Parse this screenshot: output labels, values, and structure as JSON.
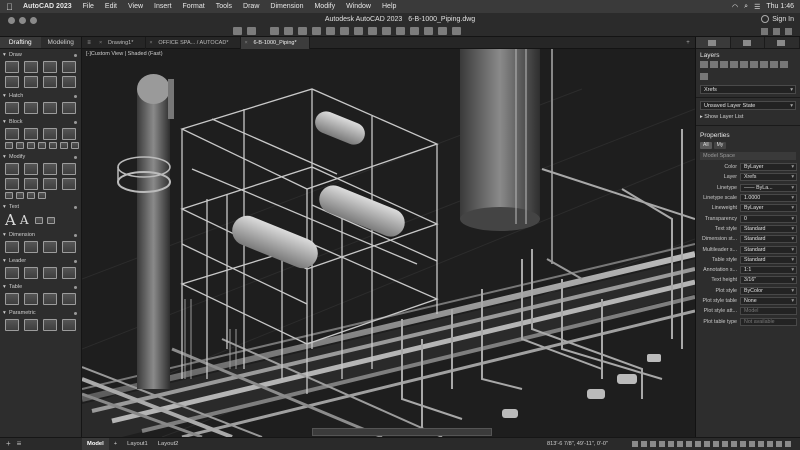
{
  "menubar": {
    "app": "AutoCAD 2023",
    "items": [
      "File",
      "Edit",
      "View",
      "Insert",
      "Format",
      "Tools",
      "Draw",
      "Dimension",
      "Modify",
      "Window",
      "Help"
    ],
    "clock": "Thu 1:46"
  },
  "window": {
    "title": "Autodesk AutoCAD 2023",
    "file": "6-B-1000_Piping.dwg",
    "sign_in": "Sign In"
  },
  "left_palette": {
    "tabs": [
      "Drafting",
      "Modeling"
    ],
    "active_tab": "Drafting",
    "sections": [
      {
        "name": "Draw",
        "icons": 8
      },
      {
        "name": "Hatch",
        "icons": 4
      },
      {
        "name": "Block",
        "icons": 8
      },
      {
        "name": "Modify",
        "icons": 12
      },
      {
        "name": "Text",
        "icons": 4
      },
      {
        "name": "Dimension",
        "icons": 4
      },
      {
        "name": "Leader",
        "icons": 4
      },
      {
        "name": "Table",
        "icons": 4
      },
      {
        "name": "Parametric",
        "icons": 8
      }
    ]
  },
  "file_tabs": [
    {
      "label": "Drawing1*",
      "active": false
    },
    {
      "label": "OFFICE SPA... / AUTOCAD*",
      "active": false
    },
    {
      "label": "6-B-1000_Piping*",
      "active": true
    }
  ],
  "viewport": {
    "label": "[-]Custom View | Shaded (Fast)"
  },
  "right_panel": {
    "layers": {
      "title": "Layers",
      "current_layer": "Xrefs",
      "layer_state": "Unsaved Layer State",
      "show_list": "Show Layer List"
    },
    "properties": {
      "title": "Properties",
      "tabs": [
        "All",
        "My"
      ],
      "scope": "Model Space",
      "rows": [
        {
          "label": "Color",
          "value": "ByLayer",
          "disabled": false
        },
        {
          "label": "Layer",
          "value": "Xrefs",
          "disabled": false
        },
        {
          "label": "Linetype",
          "value": "—— ByLa...",
          "disabled": false
        },
        {
          "label": "Linetype scale",
          "value": "1.0000",
          "disabled": false
        },
        {
          "label": "Lineweight",
          "value": "ByLayer",
          "disabled": false
        },
        {
          "label": "Transparency",
          "value": "0",
          "disabled": false
        },
        {
          "label": "Text style",
          "value": "Standard",
          "disabled": false
        },
        {
          "label": "Dimension st...",
          "value": "Standard",
          "disabled": false
        },
        {
          "label": "Multileader s...",
          "value": "Standard",
          "disabled": false
        },
        {
          "label": "Table style",
          "value": "Standard",
          "disabled": false
        },
        {
          "label": "Annotation s...",
          "value": "1:1",
          "disabled": false
        },
        {
          "label": "Text height",
          "value": "3/16\"",
          "disabled": false
        },
        {
          "label": "Plot style",
          "value": "ByColor",
          "disabled": false
        },
        {
          "label": "Plot style table",
          "value": "None",
          "disabled": false
        },
        {
          "label": "Plot style att...",
          "value": "Model",
          "disabled": true
        },
        {
          "label": "Plot table type",
          "value": "Not available",
          "disabled": true
        }
      ]
    }
  },
  "statusbar": {
    "layout_tabs": [
      "Model",
      "Layout1",
      "Layout2"
    ],
    "active_layout": "Model",
    "coordinates": "813'-6 7/8\", 49'-11\", 0'-0\""
  }
}
